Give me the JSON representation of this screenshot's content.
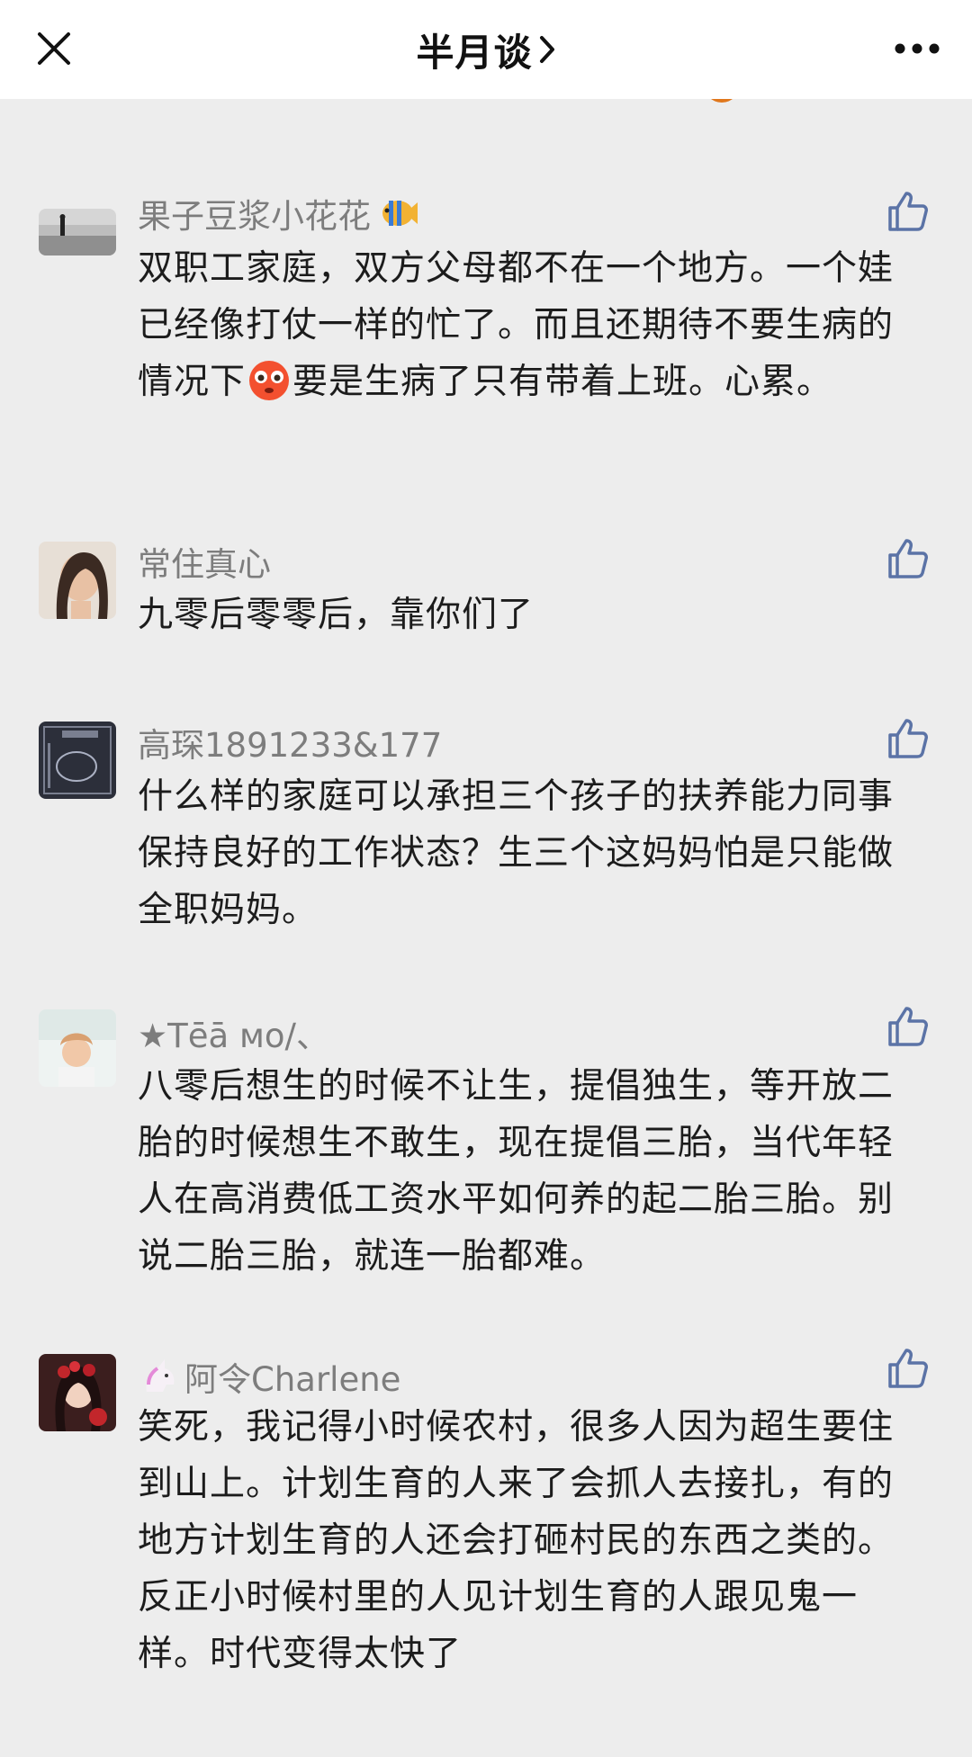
{
  "header": {
    "close_icon": "close-icon",
    "title": "半月谈",
    "chevron_icon": "chevron-right-icon",
    "more_icon": "more-dots-icon"
  },
  "comments": [
    {
      "username": "果子豆浆小花花",
      "username_emoji": "tropical-fish-emoji",
      "text_before": "双职工家庭，双方父母都不在一个地方。一个娃已经像打仗一样的忙了。而且还期待不要生病的情况下",
      "inline_emoji": "flushed-face-emoji",
      "text_after": "要是生病了只有带着上班。心累。"
    },
    {
      "username": "常住真心",
      "text": "九零后零零后，靠你们了"
    },
    {
      "username": "高琛1891233&177",
      "text": "什么样的家庭可以承担三个孩子的扶养能力同事保持良好的工作状态？生三个这妈妈怕是只能做全职妈妈。"
    },
    {
      "username": "★Tēā мo/、",
      "text": "八零后想生的时候不让生，提倡独生，等开放二胎的时候想生不敢生，现在提倡三胎，当代年轻人在高消费低工资水平如何养的起二胎三胎。别说二胎三胎，就连一胎都难。"
    },
    {
      "username_emoji": "unicorn-emoji",
      "username": "阿令Charlene",
      "text": "笑死，我记得小时候农村，很多人因为超生要住到山上。计划生育的人来了会抓人去接扎，有的地方计划生育的人还会打砸村民的东西之类的。反正小时候村里的人见计划生育的人跟见鬼一样。时代变得太快了"
    }
  ],
  "like_icon": "thumbs-up-icon",
  "colors": {
    "background": "#ededed",
    "header_bg": "#ffffff",
    "username": "#7d7d7d",
    "like_icon": "#5b73a6"
  }
}
